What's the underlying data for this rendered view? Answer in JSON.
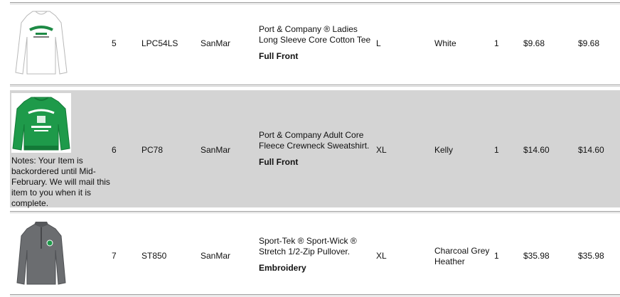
{
  "rows": [
    {
      "line": "5",
      "sku": "LPC54LS",
      "vendor": "SanMar",
      "description": "Port & Company ® Ladies Long Sleeve Core Cotton Tee",
      "decoration": "Full Front",
      "size": "L",
      "color": "White",
      "qty": "1",
      "unit_price": "$9.68",
      "total": "$9.68",
      "image": "white-long-sleeve-tee-image",
      "notes": ""
    },
    {
      "line": "6",
      "sku": "PC78",
      "vendor": "SanMar",
      "description": "Port & Company Adult Core Fleece Crewneck Sweatshirt.",
      "decoration": "Full Front",
      "size": "XL",
      "color": "Kelly",
      "qty": "1",
      "unit_price": "$14.60",
      "total": "$14.60",
      "image": "green-crewneck-sweatshirt-image",
      "notes": "Notes: Your Item is backordered until Mid-February. We will mail this item to you when it is complete."
    },
    {
      "line": "7",
      "sku": "ST850",
      "vendor": "SanMar",
      "description": "Sport-Tek ® Sport-Wick ® Stretch 1/2-Zip Pullover.",
      "decoration": "Embroidery",
      "size": "XL",
      "color": "Charcoal Grey Heather",
      "qty": "1",
      "unit_price": "$35.98",
      "total": "$35.98",
      "image": "grey-half-zip-pullover-image",
      "notes": ""
    }
  ],
  "colors": {
    "shaded_row": "#d4d4d4",
    "kelly_green": "#1e9a4a",
    "charcoal": "#6b6d70"
  }
}
